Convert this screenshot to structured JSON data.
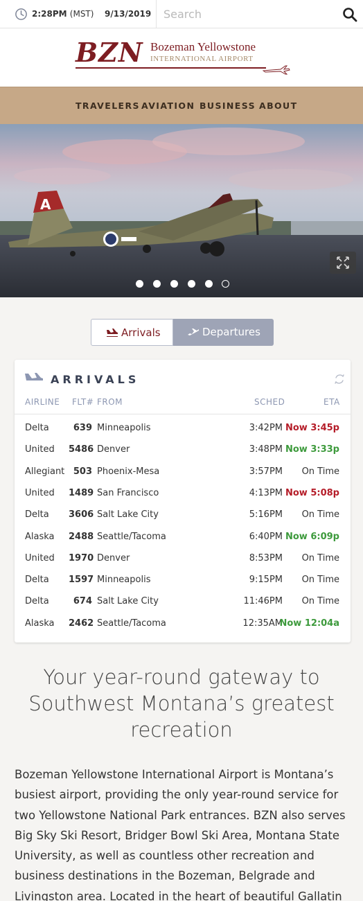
{
  "topbar": {
    "time": "2:28PM",
    "timezone": "(MST)",
    "date": "9/13/2019",
    "search_placeholder": "Search"
  },
  "logo": {
    "code": "BZN",
    "name": "Bozeman Yellowstone",
    "subtitle": "INTERNATIONAL AIRPORT"
  },
  "nav": {
    "items": [
      {
        "label": "TRAVELERS"
      },
      {
        "label": "AVIATION"
      },
      {
        "label": "BUSINESS"
      },
      {
        "label": "ABOUT"
      }
    ]
  },
  "carousel": {
    "slide_count": 6,
    "active_index": 5
  },
  "toggle": {
    "arrivals_label": "Arrivals",
    "departures_label": "Departures",
    "active": "arrivals"
  },
  "arrivals": {
    "title": "ARRIVALS",
    "columns": {
      "airline": "AIRLINE",
      "flight": "FLT#",
      "from": "FROM",
      "sched": "SCHED",
      "eta": "ETA"
    },
    "flights": [
      {
        "airline": "Delta",
        "flight": "639",
        "from": "Minneapolis",
        "sched": "3:42PM",
        "eta": "Now 3:45p",
        "status": "late"
      },
      {
        "airline": "United",
        "flight": "5486",
        "from": "Denver",
        "sched": "3:48PM",
        "eta": "Now 3:33p",
        "status": "early"
      },
      {
        "airline": "Allegiant",
        "flight": "503",
        "from": "Phoenix-Mesa",
        "sched": "3:57PM",
        "eta": "On Time",
        "status": "ontime"
      },
      {
        "airline": "United",
        "flight": "1489",
        "from": "San Francisco",
        "sched": "4:13PM",
        "eta": "Now 5:08p",
        "status": "late"
      },
      {
        "airline": "Delta",
        "flight": "3606",
        "from": "Salt Lake City",
        "sched": "5:16PM",
        "eta": "On Time",
        "status": "ontime"
      },
      {
        "airline": "Alaska",
        "flight": "2488",
        "from": "Seattle/Tacoma",
        "sched": "6:40PM",
        "eta": "Now 6:09p",
        "status": "early"
      },
      {
        "airline": "United",
        "flight": "1970",
        "from": "Denver",
        "sched": "8:53PM",
        "eta": "On Time",
        "status": "ontime"
      },
      {
        "airline": "Delta",
        "flight": "1597",
        "from": "Minneapolis",
        "sched": "9:15PM",
        "eta": "On Time",
        "status": "ontime"
      },
      {
        "airline": "Delta",
        "flight": "674",
        "from": "Salt Lake City",
        "sched": "11:46PM",
        "eta": "On Time",
        "status": "ontime"
      },
      {
        "airline": "Alaska",
        "flight": "2462",
        "from": "Seattle/Tacoma",
        "sched": "12:35AM",
        "eta": "Now 12:04a",
        "status": "early"
      }
    ]
  },
  "content": {
    "headline": "Your year-round gateway to Southwest Montana’s greatest recreation",
    "body": "Bozeman Yellowstone International Airport is Montana’s busiest airport, providing the only year-round service for two Yellowstone National Park entrances. BZN also serves Big Sky Ski Resort, Bridger Bowl Ski Area, Montana State University, as well as countless other recreation and business destinations in the Bozeman, Belgrade and Livingston area. Located in the heart of beautiful Gallatin"
  },
  "colors": {
    "brand": "#7d1d22",
    "nav_bg": "#c6a887",
    "late": "#b51d29",
    "early": "#3d9a3c",
    "toggle_inactive": "#9ea4b6"
  }
}
